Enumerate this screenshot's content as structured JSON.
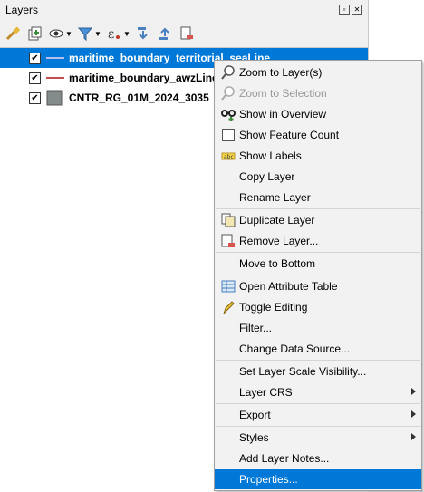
{
  "panel": {
    "title": "Layers",
    "layers": [
      {
        "name": "maritime_boundary_territorial_seaLine",
        "checked": true,
        "symbol": "line",
        "color": "#7b7fd8"
      },
      {
        "name": "maritime_boundary_awzLine",
        "checked": true,
        "symbol": "line",
        "color": "#c0504d"
      },
      {
        "name": "CNTR_RG_01M_2024_3035",
        "checked": true,
        "symbol": "fill",
        "color": "#848b8b"
      }
    ]
  },
  "menu": {
    "items": [
      {
        "label": "Zoom to Layer(s)"
      },
      {
        "label": "Zoom to Selection"
      },
      {
        "label": "Show in Overview"
      },
      {
        "label": "Show Feature Count"
      },
      {
        "label": "Show Labels"
      },
      {
        "label": "Copy Layer"
      },
      {
        "label": "Rename Layer"
      },
      {
        "label": "Duplicate Layer"
      },
      {
        "label": "Remove Layer..."
      },
      {
        "label": "Move to Bottom"
      },
      {
        "label": "Open Attribute Table"
      },
      {
        "label": "Toggle Editing"
      },
      {
        "label": "Filter..."
      },
      {
        "label": "Change Data Source..."
      },
      {
        "label": "Set Layer Scale Visibility..."
      },
      {
        "label": "Layer CRS"
      },
      {
        "label": "Export"
      },
      {
        "label": "Styles"
      },
      {
        "label": "Add Layer Notes..."
      },
      {
        "label": "Properties..."
      }
    ]
  },
  "colors": {
    "selection": "#0078d7",
    "menu_bg": "#f2f2f2"
  }
}
